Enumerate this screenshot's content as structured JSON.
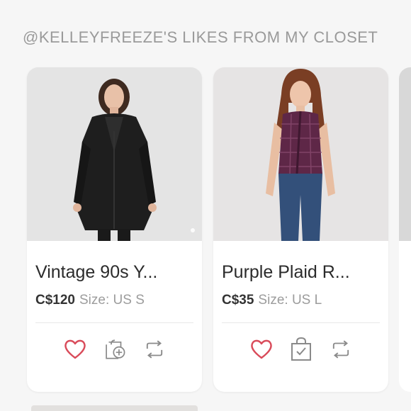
{
  "section": {
    "title": "@KELLEYFREEZE'S LIKES FROM MY CLOSET"
  },
  "cards": [
    {
      "title": "Vintage 90s Y...",
      "price": "C$120",
      "size": "Size: US S",
      "image_subject": "black leather coat",
      "actions": [
        "heart-icon",
        "add-to-bundle-icon",
        "share-repost-icon"
      ]
    },
    {
      "title": "Purple Plaid R...",
      "price": "C$35",
      "size": "Size: US L",
      "image_subject": "purple plaid sleeveless top",
      "actions": [
        "heart-icon",
        "shopping-bag-check-icon",
        "share-repost-icon"
      ]
    }
  ],
  "colors": {
    "heart": "#d94b5a",
    "icon_gray": "#8a8a8a",
    "title_gray": "#9a9a9a"
  }
}
